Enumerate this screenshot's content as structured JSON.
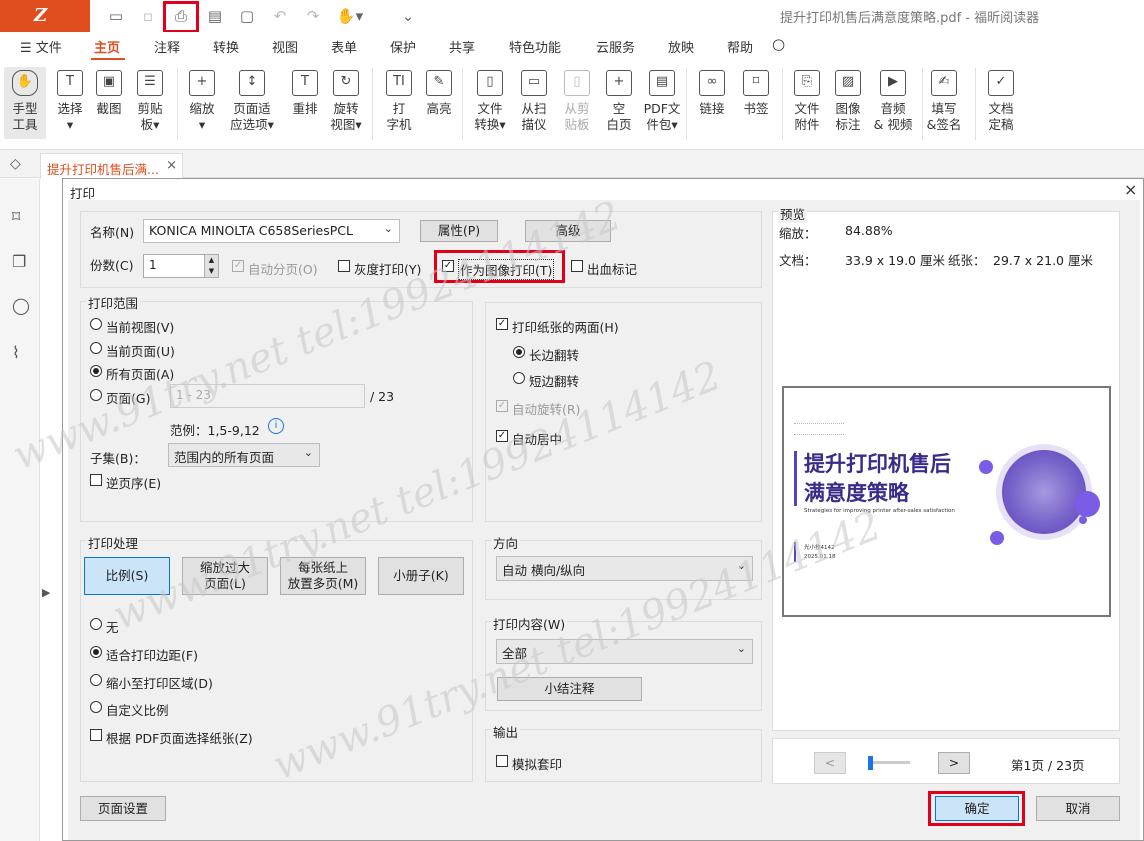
{
  "window": {
    "title": "提升打印机售后满意度策略.pdf - 福昕阅读器",
    "logo": "Z"
  },
  "menu": [
    "文件",
    "主页",
    "注释",
    "转换",
    "视图",
    "表单",
    "保护",
    "共享",
    "特色功能",
    "云服务",
    "放映",
    "帮助"
  ],
  "ribbon": [
    {
      "l1": "手型",
      "l2": "工具",
      "icon": "hand-icon",
      "g": "✋"
    },
    {
      "l1": "选择",
      "l2": "▾",
      "icon": "select-text-icon",
      "g": "T"
    },
    {
      "l1": "截图",
      "l2": "",
      "icon": "snapshot-icon",
      "g": "▣"
    },
    {
      "l1": "剪贴",
      "l2": "板▾",
      "icon": "clipboard-icon",
      "g": "☰"
    },
    {
      "l1": "缩放",
      "l2": "▾",
      "icon": "zoom-icon",
      "g": "+"
    },
    {
      "l1": "页面适",
      "l2": "应选项▾",
      "icon": "fit-page-icon",
      "g": "↕"
    },
    {
      "l1": "重排",
      "l2": "",
      "icon": "reflow-icon",
      "g": "T"
    },
    {
      "l1": "旋转",
      "l2": "视图▾",
      "icon": "rotate-view-icon",
      "g": "↻"
    },
    {
      "l1": "打",
      "l2": "字机",
      "icon": "typewriter-icon",
      "g": "TI"
    },
    {
      "l1": "高亮",
      "l2": "",
      "icon": "highlight-icon",
      "g": "✎"
    },
    {
      "l1": "文件",
      "l2": "转换▾",
      "icon": "file-convert-icon",
      "g": "▯"
    },
    {
      "l1": "从扫",
      "l2": "描仪",
      "icon": "scanner-icon",
      "g": "▭"
    },
    {
      "l1": "从剪",
      "l2": "贴板",
      "icon": "from-clipboard-icon",
      "g": "▯"
    },
    {
      "l1": "空",
      "l2": "白页",
      "icon": "blank-page-icon",
      "g": "+"
    },
    {
      "l1": "PDF文",
      "l2": "件包▾",
      "icon": "pdf-package-icon",
      "g": "▤"
    },
    {
      "l1": "链接",
      "l2": "",
      "icon": "link-icon",
      "g": "∞"
    },
    {
      "l1": "书签",
      "l2": "",
      "icon": "bookmark-icon",
      "g": "⌑"
    },
    {
      "l1": "文件",
      "l2": "附件",
      "icon": "attachment-icon",
      "g": "⎘"
    },
    {
      "l1": "图像",
      "l2": "标注",
      "icon": "image-annot-icon",
      "g": "▨"
    },
    {
      "l1": "音频",
      "l2": "& 视频",
      "icon": "media-icon",
      "g": "▶"
    },
    {
      "l1": "填写",
      "l2": "&签名",
      "icon": "fill-sign-icon",
      "g": "✍"
    },
    {
      "l1": "文档",
      "l2": "定稿",
      "icon": "finalize-icon",
      "g": "✓"
    }
  ],
  "doc_tab": {
    "label": "提升打印机售后满...",
    "close": "×"
  },
  "dialog": {
    "title": "打印",
    "close": "×",
    "printer_label": "名称(N)",
    "printer_value": "KONICA MINOLTA C658SeriesPCL",
    "properties_btn": "属性(P)",
    "advanced_btn": "高级",
    "copies_label": "份数(C)",
    "copies_value": "1",
    "collate": "自动分页(O)",
    "grayscale": "灰度打印(Y)",
    "print_as_image": "作为图像打印(T)",
    "bleed_marks": "出血标记",
    "range": {
      "title": "打印范围",
      "current_view": "当前视图(V)",
      "current_page": "当前页面(U)",
      "all_pages": "所有页面(A)",
      "pages": "页面(G)",
      "pages_placeholder": "1 - 23",
      "pages_total": "/ 23",
      "example": "范例：1,5-9,12",
      "info": "i",
      "subset_label": "子集(B)：",
      "subset_value": "范围内的所有页面",
      "reverse": "逆页序(E)"
    },
    "duplex": {
      "both_sides": "打印纸张的两面(H)",
      "long_edge": "长边翻转",
      "short_edge": "短边翻转",
      "auto_rotate": "自动旋转(R)",
      "auto_center": "自动居中"
    },
    "handling": {
      "title": "打印处理",
      "scale": "比例(S)",
      "shrink1": "缩放过大",
      "shrink2": "页面(L)",
      "multi1": "每张纸上",
      "multi2": "放置多页(M)",
      "booklet": "小册子(K)",
      "none": "无",
      "fit_margins": "适合打印边距(F)",
      "shrink_area": "缩小至打印区域(D)",
      "custom": "自定义比例",
      "choose_paper": "根据 PDF页面选择纸张(Z)"
    },
    "orientation": {
      "title": "方向",
      "value": "自动 横向/纵向"
    },
    "content": {
      "title": "打印内容(W)",
      "value": "全部",
      "summary_btn": "小结注释"
    },
    "output": {
      "title": "输出",
      "simulate": "模拟套印"
    },
    "page_setup_btn": "页面设置",
    "ok_btn": "确定",
    "cancel_btn": "取消",
    "preview": {
      "title": "预览",
      "zoom_label": "缩放：",
      "zoom_value": "84.88%",
      "doc_label": "文档：",
      "doc_value": "33.9 x 19.0 厘米",
      "paper_label": "纸张：",
      "paper_value": "29.7 x 21.0 厘米",
      "page_title_1": "提升打印机售后",
      "page_title_2": "满意度策略",
      "page_subtitle": "Strategies for improving printer after-sales satisfaction",
      "page_author": "光小技4142",
      "page_date": "2025.01.18",
      "prev": "<",
      "next": ">",
      "page_indicator": "第1页 / 23页",
      "slider_position": 0.05
    }
  },
  "watermark": [
    "www.91try.net  tel:19924114142",
    "www.91try.net  tel:19924114142",
    "www.91try.net  tel:19924114142"
  ],
  "colors": {
    "brand": "#e04e1f",
    "highlight": "#e0001b",
    "accent": "#5a3fc0",
    "primary_btn": "#cce4f7"
  }
}
